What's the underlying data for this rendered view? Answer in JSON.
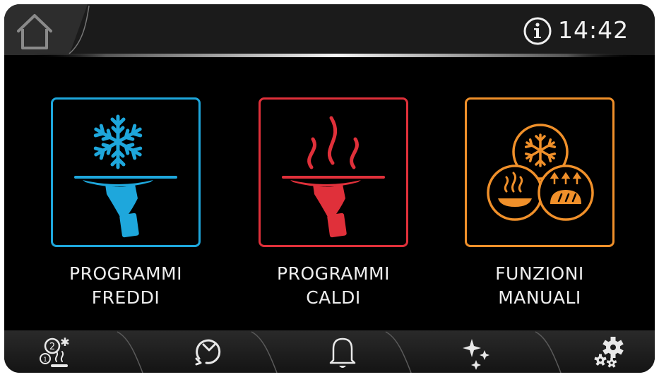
{
  "header": {
    "home_icon": "home-icon",
    "info_icon": "info-icon",
    "time": "14:42"
  },
  "tiles": [
    {
      "line1": "PROGRAMMI",
      "line2": "FREDDI",
      "color": "#1ea7dc",
      "icon": "cold-serving-icon"
    },
    {
      "line1": "PROGRAMMI",
      "line2": "CALDI",
      "color": "#e0303a",
      "icon": "hot-serving-icon"
    },
    {
      "line1": "FUNZIONI",
      "line2": "MANUALI",
      "color": "#f0902a",
      "icon": "manual-functions-icon"
    }
  ],
  "nav": [
    {
      "icon": "multi-program-icon"
    },
    {
      "icon": "timer-icon"
    },
    {
      "icon": "bell-icon"
    },
    {
      "icon": "sparkle-icon"
    },
    {
      "icon": "settings-icon"
    }
  ],
  "colors": {
    "cold": "#1ea7dc",
    "hot": "#e0303a",
    "manual": "#f0902a",
    "text": "#eeeeee",
    "background": "#000000"
  }
}
